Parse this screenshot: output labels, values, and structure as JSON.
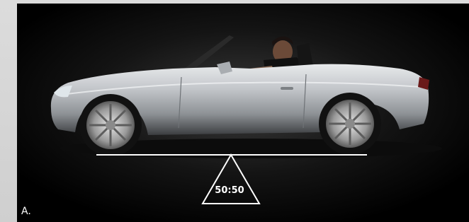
{
  "caption": "A.",
  "balance_ratio": "50:50",
  "colors": {
    "background": "#000000",
    "frame": "#d6d6d6",
    "car_silver": "#b9bcc0",
    "line": "#ffffff"
  },
  "icons": {
    "balance": "triangle-fulcrum-icon"
  }
}
